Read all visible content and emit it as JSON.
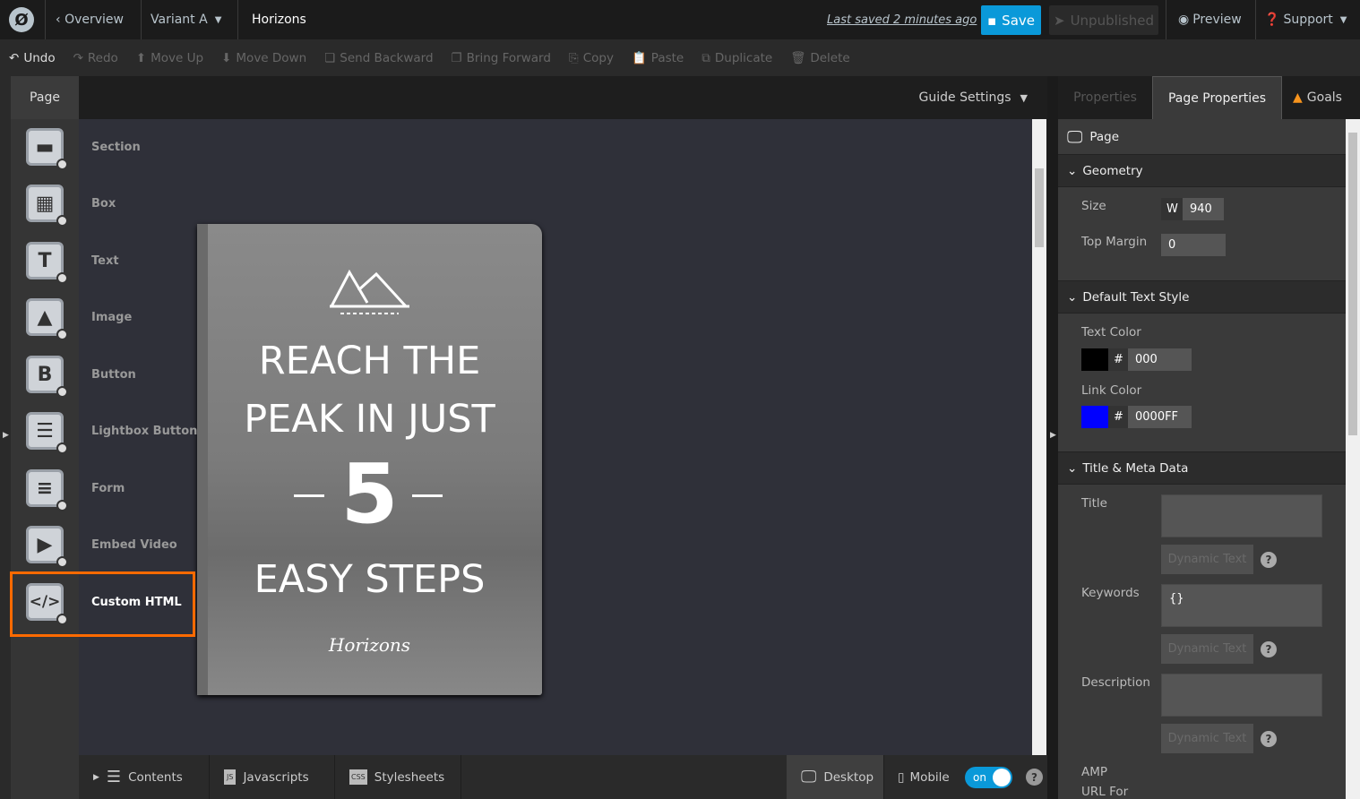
{
  "topbar": {
    "overview": "Overview",
    "variant": "Variant A",
    "page_name": "Horizons",
    "last_saved": "Last saved  2 minutes ago",
    "save": "Save",
    "unpublished": "Unpublished",
    "preview": "Preview",
    "support": "Support"
  },
  "toolbar": [
    "Undo",
    "Redo",
    "Move Up",
    "Move Down",
    "Send Backward",
    "Bring Forward",
    "Copy",
    "Paste",
    "Duplicate",
    "Delete"
  ],
  "left": {
    "tab": "Page",
    "elements": [
      "Section",
      "Box",
      "Text",
      "Image",
      "Button",
      "Lightbox Button",
      "Form",
      "Embed Video",
      "Custom HTML"
    ]
  },
  "canvas": {
    "guide_settings": "Guide Settings",
    "book": {
      "line1": "REACH THE",
      "line2": "PEAK IN JUST",
      "number": "5",
      "line3": "EASY STEPS",
      "brand": "Horizons"
    }
  },
  "bottom": {
    "contents": "Contents",
    "javascripts": "Javascripts",
    "stylesheets": "Stylesheets",
    "desktop": "Desktop",
    "mobile": "Mobile",
    "toggle": "on",
    "help": "?"
  },
  "right": {
    "tabs": [
      "Properties",
      "Page Properties",
      "Goals"
    ],
    "page": "Page",
    "geometry": "Geometry",
    "size_label": "Size",
    "w": "W",
    "width": "940",
    "top_margin_label": "Top Margin",
    "top_margin": "0",
    "text_style": "Default Text Style",
    "text_color_label": "Text Color",
    "text_color": "000",
    "link_color_label": "Link Color",
    "link_color": "0000FF",
    "hash": "#",
    "meta": "Title & Meta Data",
    "title_label": "Title",
    "keywords_label": "Keywords",
    "keywords": "{}",
    "description_label": "Description",
    "dynamic": "Dynamic Text",
    "amp1": "AMP",
    "amp2": "URL For",
    "help": "?"
  },
  "colors": {
    "accent": "#0a99d9",
    "highlight": "#ff6a00",
    "text_color": "#000000",
    "link_color": "#0000ff"
  }
}
